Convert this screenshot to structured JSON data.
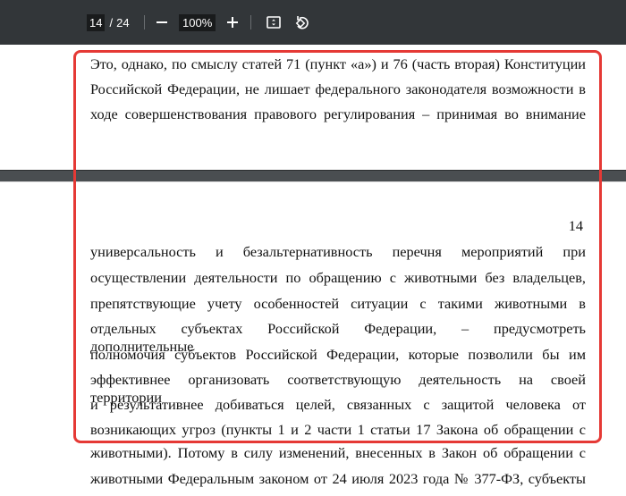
{
  "toolbar": {
    "current_page": "14",
    "page_separator": "/",
    "total_pages": "24",
    "zoom_out_icon": "minus-icon",
    "zoom_level": "100%",
    "zoom_in_icon": "plus-icon",
    "fit_icon": "fit-page-icon",
    "rotate_icon": "rotate-icon"
  },
  "page_top": {
    "lines": [
      "Это, однако, по смыслу статей 71 (пункт «а») и 76 (часть вторая) Конституции",
      "Российской Федерации, не лишает федерального законодателя возможности в",
      "ходе совершенствования правового регулирования – принимая во внимание"
    ]
  },
  "page_bottom": {
    "page_number": "14",
    "lines": [
      "универсальность и безальтернативность перечня мероприятий при",
      "осуществлении деятельности по обращению с животными без владельцев,",
      "препятствующие учету особенностей ситуации с такими животными в",
      "отдельных субъектах Российской Федерации, – предусмотреть дополнительные",
      "полномочия субъектов Российской Федерации, которые позволили бы им",
      "эффективнее организовать соответствующую деятельность на своей территории",
      "и результативнее добиваться целей, связанных с защитой человека от",
      "возникающих угроз (пункты 1 и 2 части 1 статьи 17 Закона об обращении с",
      "животными). Потому в силу изменений, внесенных в Закон об обращении с",
      "животными Федеральным законом от 24 июля 2023 года № 377-ФЗ, субъекты"
    ]
  },
  "highlight_color": "#e53935"
}
